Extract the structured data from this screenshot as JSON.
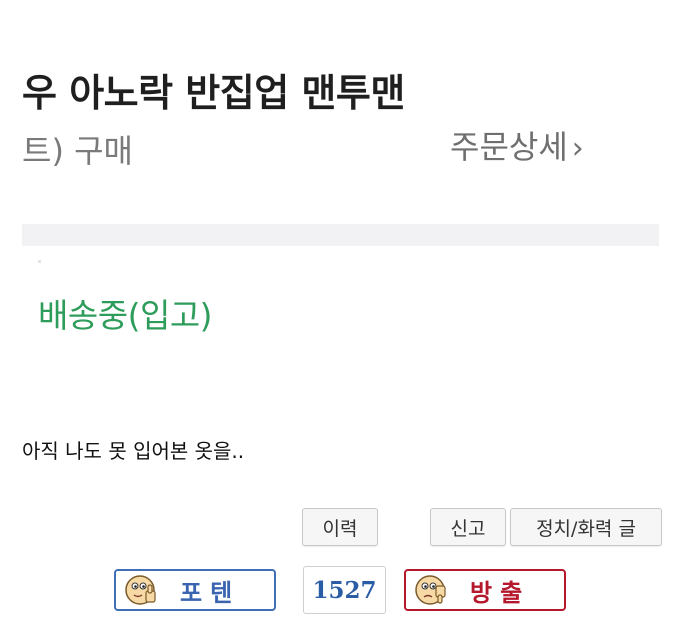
{
  "screenshot": {
    "product_title": "우 아노락 반집업 맨투맨",
    "purchase_text": "트) 구매",
    "order_detail_label": "주문상세",
    "order_detail_chevron": "›",
    "shipping_status": "배송중(입고)"
  },
  "post": {
    "body_text": "아직 나도 못 입어본 옷을.."
  },
  "buttons": {
    "history": "이력",
    "report": "신고",
    "suspend_history": "정치/화력 글"
  },
  "votes": {
    "upvote_label": "포텐",
    "upvote_icon": "thumbs-up-face-icon",
    "count": "1527",
    "downvote_label": "방출",
    "downvote_icon": "thumbs-down-face-icon"
  },
  "colors": {
    "shipping_status": "#2e9d5b",
    "upvote": "#3a63b0",
    "downvote": "#b5182d",
    "count": "#2b5da6"
  }
}
